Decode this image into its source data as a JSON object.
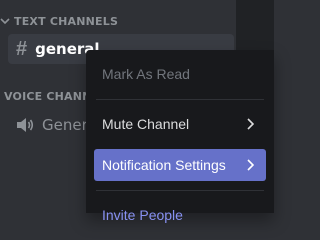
{
  "sidebar": {
    "categories": [
      {
        "label": "TEXT CHANNELS"
      },
      {
        "label": "VOICE CHANNELS"
      }
    ],
    "channels": [
      {
        "name": "general",
        "type": "text"
      },
      {
        "name": "General",
        "type": "voice"
      }
    ]
  },
  "context_menu": {
    "items": [
      {
        "label": "Mark As Read",
        "state": "disabled"
      },
      {
        "label": "Mute Channel",
        "state": "normal",
        "has_submenu": true
      },
      {
        "label": "Notification Settings",
        "state": "active",
        "has_submenu": true
      },
      {
        "label": "Invite People",
        "state": "link"
      }
    ]
  },
  "colors": {
    "sidebar_bg": "#2f3136",
    "menu_bg": "#18191c",
    "active_item": "#6671c9",
    "invite_link": "#8891f2",
    "muted_text": "#8e9297"
  },
  "icons": {
    "text_channel": "hashtag-icon",
    "voice_channel": "speaker-icon",
    "category_collapse": "chevron-down-icon",
    "submenu": "chevron-right-icon"
  }
}
